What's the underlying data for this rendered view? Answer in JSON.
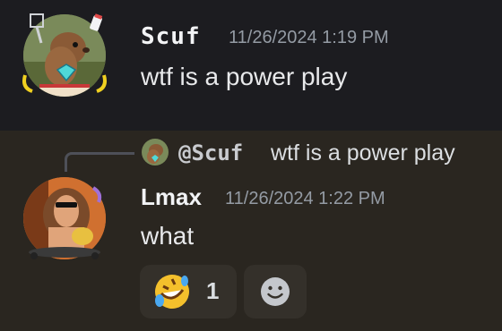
{
  "messages": [
    {
      "username": "Scuf",
      "timestamp": "11/26/2024 1:19 PM",
      "content": "wtf is a power play"
    },
    {
      "username": "Lmax",
      "timestamp": "11/26/2024 1:22 PM",
      "content": "what",
      "reply": {
        "username": "@Scuf",
        "content": "wtf is a power play"
      },
      "reactions": [
        {
          "emoji": "rolling-on-floor-laughing",
          "count": "1"
        }
      ]
    }
  ],
  "icons": {
    "add_reaction": "smiley-icon"
  },
  "colors": {
    "background_top": "#1c1c20",
    "background_bottom": "#2a2620",
    "username": "#f2f3f5",
    "timestamp": "#949ba4",
    "reaction_bg": "#34302a"
  }
}
